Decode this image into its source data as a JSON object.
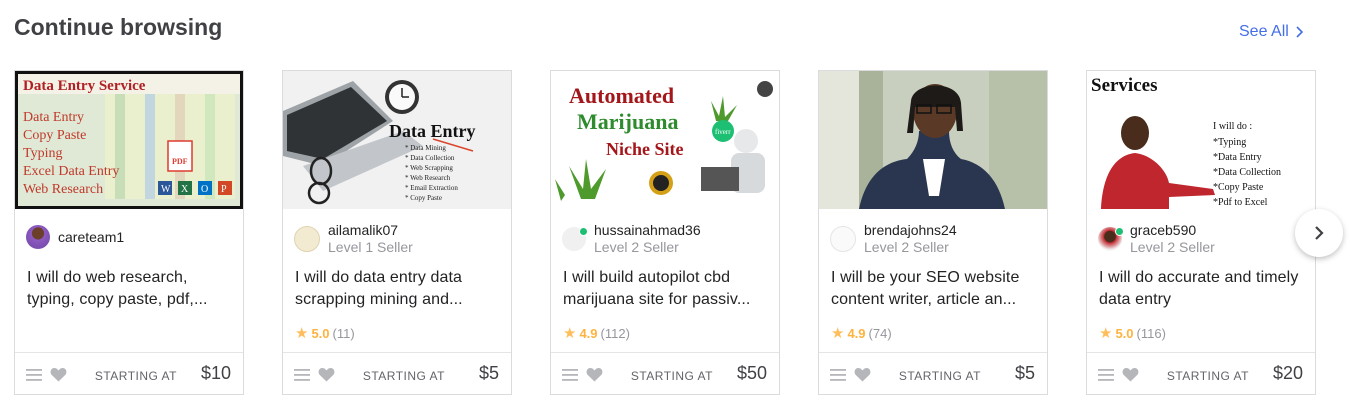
{
  "section": {
    "title": "Continue browsing",
    "see_all": "See All"
  },
  "colors": {
    "accent": "#446ee7",
    "star": "#ffb33e",
    "online": "#1dbf73"
  },
  "gigs": [
    {
      "seller": "careteam1",
      "level": "",
      "title": "I will do web research, typing, copy paste, pdf,...",
      "rating": "",
      "reviews": "",
      "starting_label": "STARTING AT",
      "price": "$10",
      "thumb": {
        "heading": "Data Entry Service",
        "lines": [
          "Data Entry",
          "Copy Paste",
          "Typing",
          "Excel Data Entry",
          "Web Research"
        ],
        "badge": "PDF",
        "apps": [
          "W",
          "X",
          "O",
          "P"
        ]
      }
    },
    {
      "seller": "ailamalik07",
      "level": "Level 1 Seller",
      "title": "I will do data entry data scrapping mining and...",
      "rating": "5.0",
      "reviews": "(11)",
      "starting_label": "STARTING AT",
      "price": "$5",
      "thumb": {
        "heading": "Data Entry",
        "lines": [
          "* Data Mining",
          "* Data Collection",
          "* Web Scrapping",
          "* Web Research",
          "* Email Extraction",
          "* Copy Paste"
        ]
      }
    },
    {
      "seller": "hussainahmad36",
      "level": "Level 2 Seller",
      "title": "I will build autopilot cbd marijuana site for passiv...",
      "rating": "4.9",
      "reviews": "(112)",
      "starting_label": "STARTING AT",
      "price": "$50",
      "thumb": {
        "line1": "Automated",
        "line2": "Marijuana",
        "line3": "Niche Site",
        "brand": "fiverr"
      }
    },
    {
      "seller": "brendajohns24",
      "level": "Level 2 Seller",
      "title": "I will be your SEO website content writer, article an...",
      "rating": "4.9",
      "reviews": "(74)",
      "starting_label": "STARTING AT",
      "price": "$5"
    },
    {
      "seller": "graceb590",
      "level": "Level 2 Seller",
      "title": "I will do accurate and timely data entry",
      "rating": "5.0",
      "reviews": "(116)",
      "starting_label": "STARTING AT",
      "price": "$20",
      "thumb": {
        "heading": "Services",
        "intro": "I will do :",
        "lines": [
          "*Typing",
          "*Data Entry",
          "*Data Collection",
          "*Copy Paste",
          "*Pdf to Excel"
        ]
      }
    }
  ]
}
